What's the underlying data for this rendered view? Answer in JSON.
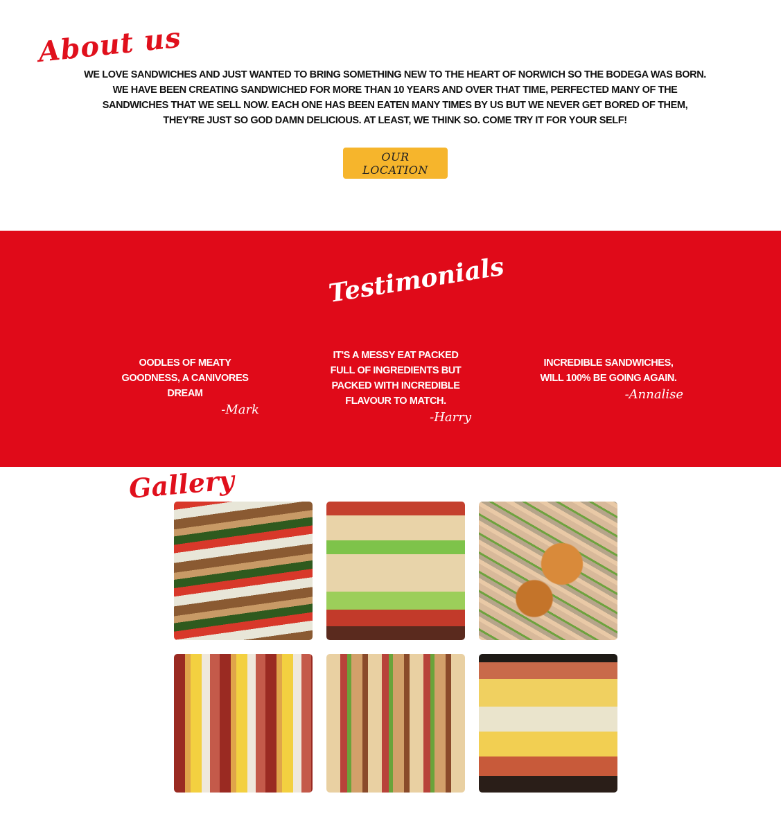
{
  "about": {
    "title": "About us",
    "text": "We love sandwiches and just wanted to bring something new to the heart of Norwich so The Bodega was born. We have been creating sandwiched for more than 10 years and over that time, perfected many of the sandwiches that we sell now. Each one has been eaten many times by us but we never get bored of them, they're just so god damn delicious. At least, we think so. Come try it for your self!",
    "location_button": "Our Location"
  },
  "testimonials": {
    "title": "Testimonials",
    "items": [
      {
        "quote": "Oodles of meaty goodness, a canivores dream",
        "author": "-Mark"
      },
      {
        "quote": "It's a messy eat packed full of ingredients but packed with incredible flavour to match.",
        "author": "-Harry"
      },
      {
        "quote": "Incredible sandwiches, will 100% be going again.",
        "author": "-Annalise"
      }
    ]
  },
  "gallery": {
    "title": "Gallery"
  },
  "colors": {
    "accent_red": "#e00a19",
    "button_yellow": "#f6b52c"
  }
}
